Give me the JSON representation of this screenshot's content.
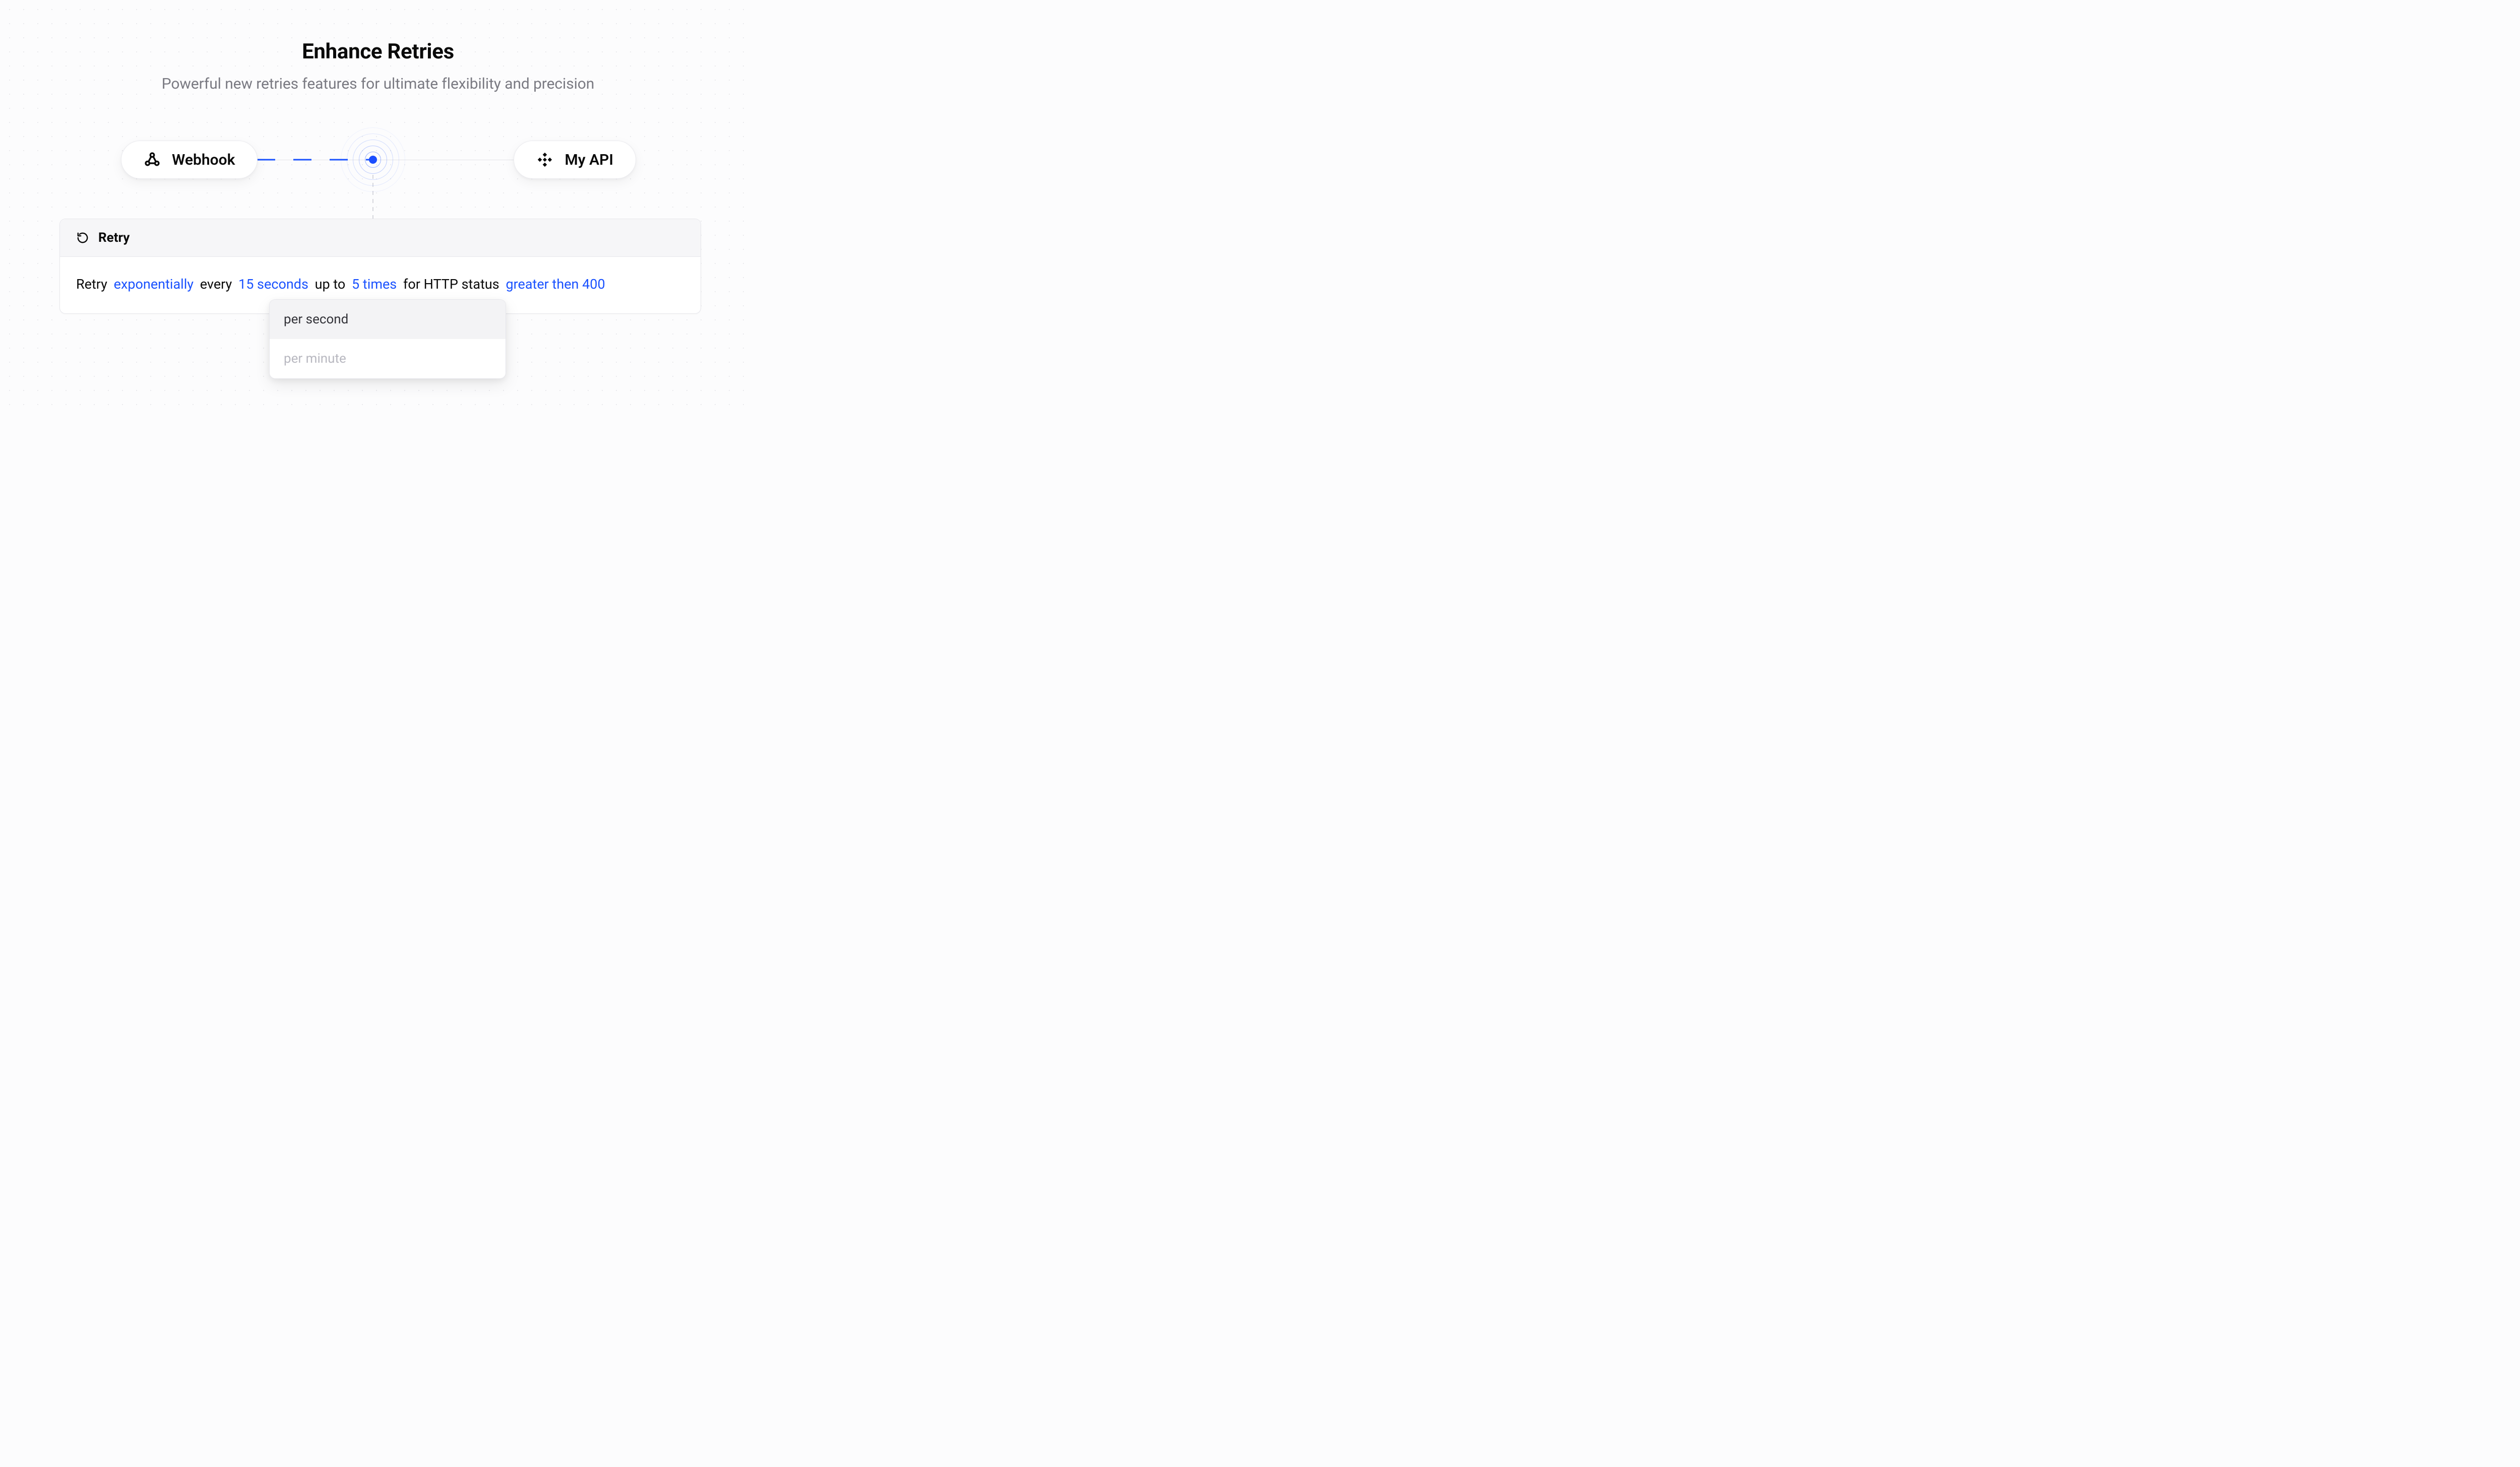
{
  "header": {
    "title": "Enhance Retries",
    "subtitle": "Powerful new retries features for ultimate flexibility and precision"
  },
  "nodes": {
    "left": {
      "label": "Webhook"
    },
    "right": {
      "label": "My API"
    }
  },
  "card": {
    "title": "Retry",
    "sentence": {
      "prefix": "Retry",
      "strategy": "exponentially",
      "every_label": "every",
      "interval": "15 seconds",
      "upto_label": "up to",
      "count": "5 times",
      "status_label": "for HTTP status",
      "condition": "greater then 400"
    }
  },
  "dropdown": {
    "options": [
      "per second",
      "per minute"
    ],
    "selected_index": 0
  },
  "colors": {
    "accent": "#1a52ff",
    "text": "#0a0a0a",
    "muted": "#7a7a82",
    "border": "#e7e7ec",
    "panel": "#f6f6f8"
  }
}
